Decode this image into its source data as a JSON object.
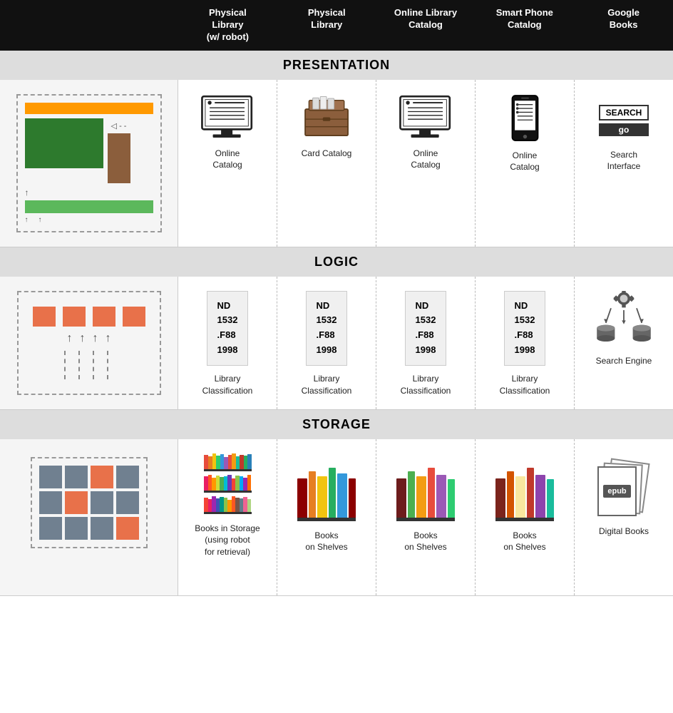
{
  "header": {
    "col1": "Physical\nLibrary\n(w/ robot)",
    "col2": "Physical\nLibrary",
    "col3": "Online Library\nCatalog",
    "col4": "Smart Phone\nCatalog",
    "col5": "Google\nBooks"
  },
  "sections": {
    "presentation": {
      "label": "PRESENTATION",
      "items": [
        {
          "label": "Online\nCatalog"
        },
        {
          "label": "Card Catalog"
        },
        {
          "label": "Online\nCatalog"
        },
        {
          "label": "Online\nCatalog"
        },
        {
          "label": "Search\nInterface"
        }
      ]
    },
    "logic": {
      "label": "LOGIC",
      "items": [
        {
          "label": "Library\nClassification"
        },
        {
          "label": "Library\nClassification"
        },
        {
          "label": "Library\nClassification"
        },
        {
          "label": "Library\nClassification"
        },
        {
          "label": "Search Engine"
        }
      ],
      "classification_code": "ND\n1532\n.F88\n1998"
    },
    "storage": {
      "label": "STORAGE",
      "items": [
        {
          "label": "Books in Storage\n(using robot\nfor retrieval)"
        },
        {
          "label": "Books\non Shelves"
        },
        {
          "label": "Books\non Shelves"
        },
        {
          "label": "Books\non Shelves"
        },
        {
          "label": "Digital Books"
        }
      ]
    }
  },
  "ui": {
    "search_label": "SEARCH",
    "go_label": "go"
  }
}
